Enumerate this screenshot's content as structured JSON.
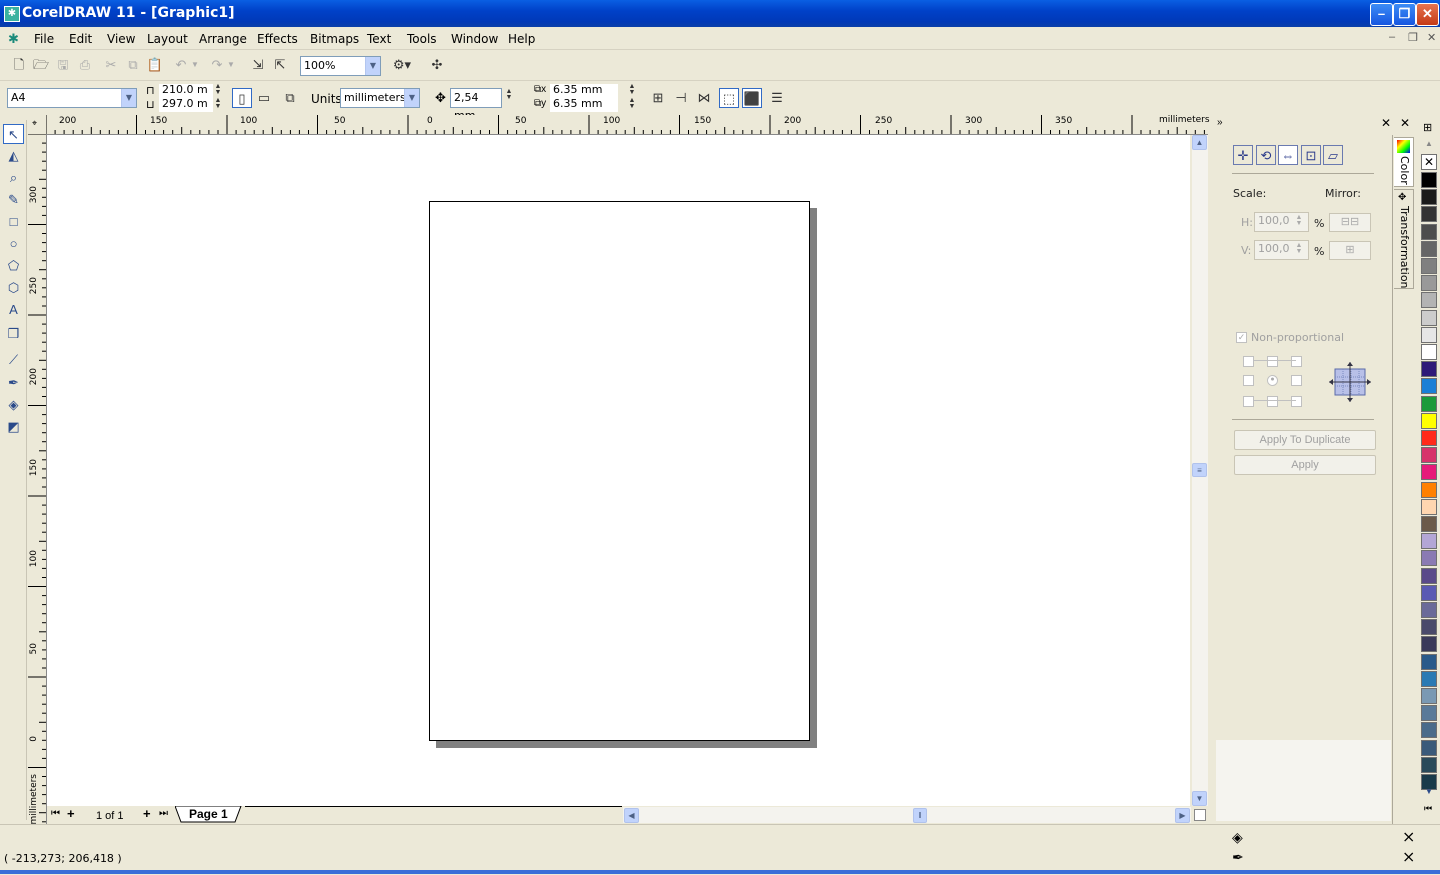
{
  "window": {
    "title": "CorelDRAW 11 - [Graphic1]",
    "app_icon": "coreldraw-icon"
  },
  "menu": [
    "File",
    "Edit",
    "View",
    "Layout",
    "Arrange",
    "Effects",
    "Bitmaps",
    "Text",
    "Tools",
    "Window",
    "Help"
  ],
  "standard_toolbar": {
    "zoom": "100%"
  },
  "property_bar": {
    "paper": "A4",
    "width": "210.0 m",
    "height": "297.0 m",
    "units_label": "Units:",
    "units": "millimeters",
    "nudge": "2,54 mm",
    "dup_x": "6.35 mm",
    "dup_y": "6.35 mm"
  },
  "rulers": {
    "h_labels": [
      "200",
      "150",
      "100",
      "50",
      "0",
      "50",
      "100",
      "150",
      "200",
      "250",
      "300",
      "350"
    ],
    "h_units": "millimeters",
    "v_labels": [
      "300",
      "250",
      "200",
      "150",
      "100",
      "50",
      "0"
    ],
    "v_units": "millimeters"
  },
  "page_nav": {
    "count": "1 of 1",
    "tab": "Page 1"
  },
  "docker": {
    "scale_label": "Scale:",
    "mirror_label": "Mirror:",
    "h_label": "H:",
    "h_value": "100,0",
    "v_label": "V:",
    "v_value": "100,0",
    "percent": "%",
    "nonprop": "Non-proportional",
    "apply_dup": "Apply To Duplicate",
    "apply": "Apply",
    "tabs": [
      "Color",
      "Transformation"
    ]
  },
  "palette": [
    "#000000",
    "#1a1a1a",
    "#333333",
    "#4d4d4d",
    "#666666",
    "#808080",
    "#999999",
    "#b3b3b3",
    "#cccccc",
    "#e6e6e6",
    "#ffffff",
    "#2e1a78",
    "#1a7fd6",
    "#1a9a3a",
    "#ffff00",
    "#ff2a1a",
    "#d6336b",
    "#e61a7a",
    "#ff8000",
    "#ffd6b0",
    "#6b5a4a",
    "#b3a6d6",
    "#8a7ab3",
    "#5a4a8a",
    "#5a5ab3",
    "#6b6b99",
    "#4a4a6b",
    "#3a3a5a",
    "#2a5a8a",
    "#2a7ab3",
    "#7a99b3",
    "#5a7a99",
    "#4a6b8a",
    "#3a5a7a",
    "#2a4a5a",
    "#1a3a4a"
  ],
  "status": {
    "coords": "( -213,273; 206,418 )"
  }
}
